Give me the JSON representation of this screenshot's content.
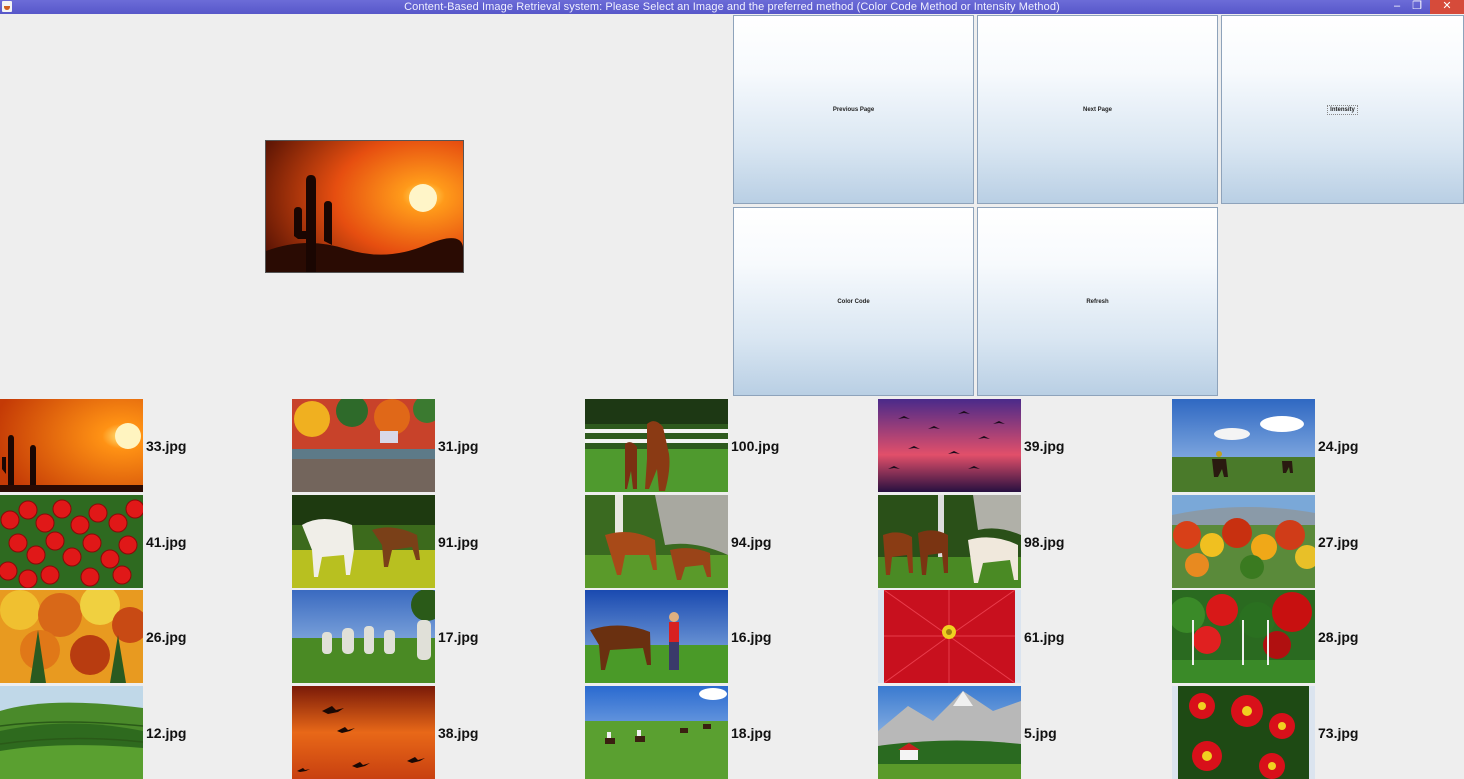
{
  "window": {
    "title": "Content-Based Image Retrieval system: Please Select an Image and the preferred method (Color Code Method or Intensity Method)",
    "minimize": "–",
    "maximize": "❐",
    "close": "✕"
  },
  "buttons": {
    "previous": "Previous Page",
    "next": "Next Page",
    "intensity": "Intensity",
    "color_code": "Color Code",
    "refresh": "Refresh"
  },
  "selected_image": {
    "icon": "desert-sunset-image"
  },
  "results": [
    {
      "file": "33.jpg",
      "scene": "sunset"
    },
    {
      "file": "31.jpg",
      "scene": "autumn-lake"
    },
    {
      "file": "100.jpg",
      "scene": "horses-fence"
    },
    {
      "file": "39.jpg",
      "scene": "birds-sky"
    },
    {
      "file": "24.jpg",
      "scene": "cowboys-field"
    },
    {
      "file": "41.jpg",
      "scene": "red-berries"
    },
    {
      "file": "91.jpg",
      "scene": "horses-meadow"
    },
    {
      "file": "94.jpg",
      "scene": "horses-rocks"
    },
    {
      "file": "98.jpg",
      "scene": "horses-forest"
    },
    {
      "file": "27.jpg",
      "scene": "autumn-trees"
    },
    {
      "file": "26.jpg",
      "scene": "autumn-forest"
    },
    {
      "file": "17.jpg",
      "scene": "tombstones"
    },
    {
      "file": "16.jpg",
      "scene": "cowboy-horse"
    },
    {
      "file": "61.jpg",
      "scene": "red-flower"
    },
    {
      "file": "28.jpg",
      "scene": "red-forest"
    },
    {
      "file": "12.jpg",
      "scene": "green-hills"
    },
    {
      "file": "38.jpg",
      "scene": "birds-orange"
    },
    {
      "file": "18.jpg",
      "scene": "riders-field"
    },
    {
      "file": "5.jpg",
      "scene": "mountain-house"
    },
    {
      "file": "73.jpg",
      "scene": "red-primrose"
    }
  ]
}
